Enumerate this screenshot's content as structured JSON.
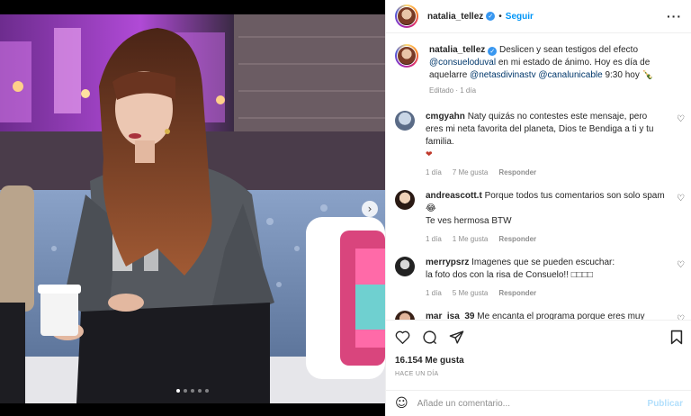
{
  "post": {
    "username": "natalia_tellez",
    "separator": "•",
    "follow_label": "Seguir",
    "more_label": "···",
    "caption_username": "natalia_tellez",
    "caption_part1": "Deslicen y sean testigos del efecto",
    "caption_mention1": "@consueloduval",
    "caption_part2": "en mi estado de ánimo. Hoy es día de aquelarre",
    "caption_mention2": "@netasdivinastv",
    "caption_mention3": "@canalunicable",
    "caption_part3": "9:30 hoy",
    "caption_emoji": "🍾",
    "caption_meta": "Editado · 1 día"
  },
  "comments": [
    {
      "username": "cmgyahn",
      "text": "Naty quizás no contestes este mensaje, pero eres mi neta favorita del planeta, Dios te Bendiga a ti y tu familia.",
      "emoji": "❤",
      "time": "1 día",
      "likes": "7 Me gusta",
      "reply": "Responder"
    },
    {
      "username": "andreascott.t",
      "text": "Porque todos tus comentarios son solo spam",
      "emoji": "😂",
      "text2": "Te ves hermosa BTW",
      "time": "1 día",
      "likes": "1 Me gusta",
      "reply": "Responder"
    },
    {
      "username": "merrypsrz",
      "text": "Imagenes que se pueden escuchar:",
      "text2": "la foto dos con la risa de Consuelo!! ",
      "text2_glyphs": "□□□□",
      "time": "1 día",
      "likes": "5 Me gusta",
      "reply": "Responder"
    },
    {
      "username": "mar_isa_39",
      "text": "Me encanta el programa porque eres muy agradable al igual que gali, las demás no me agradan"
    }
  ],
  "actions": {
    "likes": "16.154 Me gusta",
    "ago": "HACE UN DÍA"
  },
  "add_comment": {
    "placeholder": "Añade un comentario...",
    "publish": "Publicar",
    "emoji_icon": "☺"
  },
  "carousel": {
    "next_icon": "›",
    "slides": 5,
    "active": 0
  },
  "colors": {
    "accent": "#0095f6",
    "verified": "#3897f0",
    "muted": "#8e8e8e",
    "link": "#00376b"
  }
}
